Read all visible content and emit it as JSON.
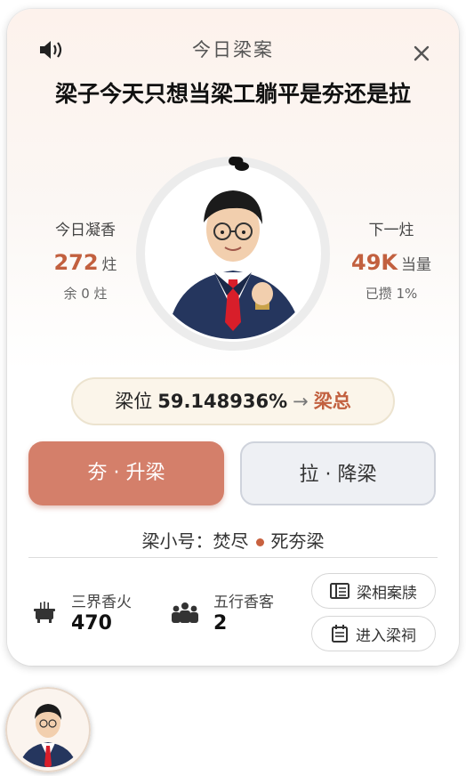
{
  "header": {
    "title": "今日梁案",
    "topic": "梁子今天只想当梁工躺平是夯还是拉"
  },
  "icons": {
    "sound": "speaker-icon",
    "close": "close-icon",
    "incense": "incense-burner-icon",
    "visitors": "crowd-icon",
    "archive": "book-icon",
    "enter": "calendar-icon"
  },
  "left_stat": {
    "label": "今日凝香",
    "value": "272",
    "unit": "炷",
    "sub": "余 0 炷"
  },
  "right_stat": {
    "label": "下一炷",
    "value": "49K",
    "unit": "当量",
    "sub": "已攒 1%"
  },
  "progress": {
    "percent": 1
  },
  "rank": {
    "label": "梁位",
    "percent": "59.148936%",
    "arrow": "→",
    "target": "梁总"
  },
  "actions": {
    "up": "夯 · 升梁",
    "down": "拉 · 降梁"
  },
  "alias": {
    "label": "梁小号：",
    "name1": "焚尽",
    "name2": "死夯梁"
  },
  "stats": {
    "incense_label": "三界香火",
    "incense_value": "470",
    "visitors_label": "五行香客",
    "visitors_value": "2"
  },
  "side_buttons": {
    "archive": "梁相案牍",
    "enter": "进入梁祠"
  },
  "colors": {
    "accent": "#c2603f",
    "up_button": "#d47f6a",
    "down_button": "#eef0f4"
  }
}
